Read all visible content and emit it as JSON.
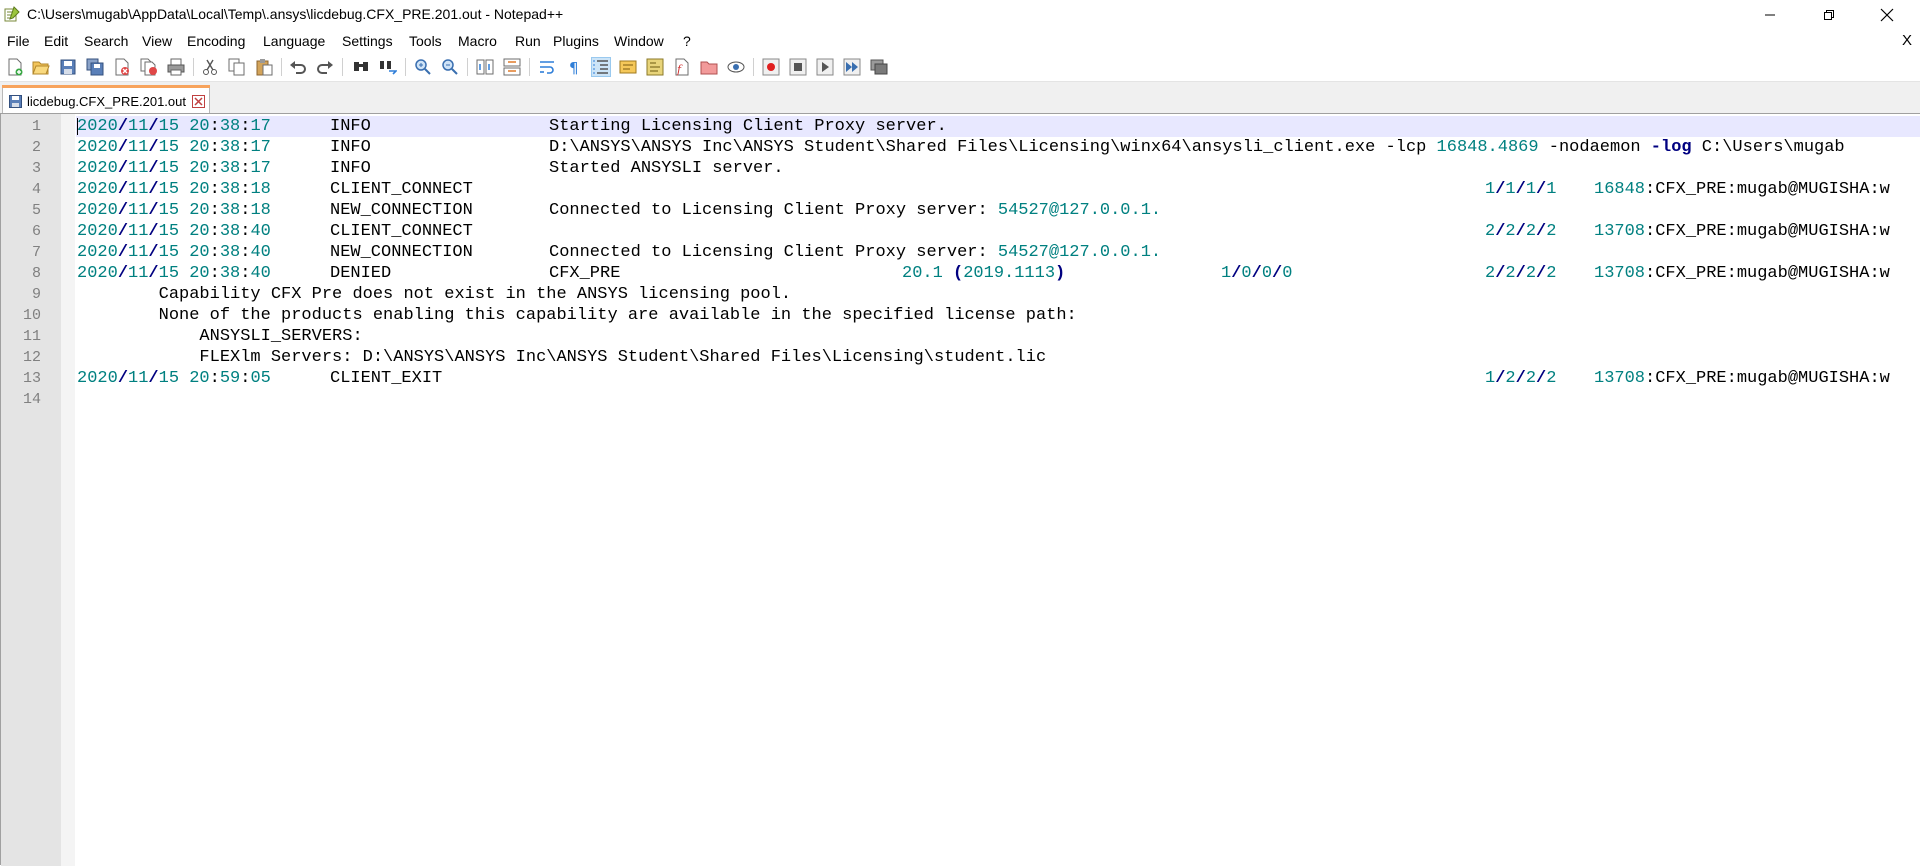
{
  "window": {
    "title": "C:\\Users\\mugab\\AppData\\Local\\Temp\\.ansys\\licdebug.CFX_PRE.201.out - Notepad++"
  },
  "menu": [
    "File",
    "Edit",
    "Search",
    "View",
    "Encoding",
    "Language",
    "Settings",
    "Tools",
    "Macro",
    "Run",
    "Plugins",
    "Window",
    "?"
  ],
  "menu_close": "X",
  "toolbar_icons": [
    "new-file-icon",
    "open-file-icon",
    "save-icon",
    "save-all-icon",
    "close-icon",
    "close-all-icon",
    "print-icon",
    "cut-icon",
    "copy-icon",
    "paste-icon",
    "undo-icon",
    "redo-icon",
    "find-icon",
    "replace-icon",
    "zoom-in-icon",
    "zoom-out-icon",
    "sync-vertical-icon",
    "sync-horizontal-icon",
    "word-wrap-icon",
    "show-all-chars-icon",
    "indent-guide-icon",
    "udl-icon",
    "doc-map-icon",
    "function-list-icon",
    "folder-workspace-icon",
    "monitoring-icon",
    "record-macro-icon",
    "stop-macro-icon",
    "play-macro-icon",
    "run-macro-multiple-icon",
    "save-macro-icon"
  ],
  "tab": {
    "label": "licdebug.CFX_PRE.201.out"
  },
  "colors": {
    "number": "#008080",
    "keyword": "#000080",
    "current_line": "#e8e8ff",
    "tab_accent": "#f7a35c",
    "gutter": "#e4e4e4"
  },
  "editor": {
    "line_numbers": [
      "1",
      "2",
      "3",
      "4",
      "5",
      "6",
      "7",
      "8",
      "9",
      "10",
      "11",
      "12",
      "13",
      "14"
    ],
    "lines": {
      "l1": {
        "ts_d1": "2020",
        "ts_s1": "/",
        "ts_d2": "11",
        "ts_s2": "/",
        "ts_d3": "15",
        "ts_sp": " ",
        "ts_t1": "20",
        "ts_c1": ":",
        "ts_t2": "38",
        "ts_c2": ":",
        "ts_t3": "17",
        "type": "INFO",
        "msg": "Starting Licensing Client Proxy server."
      },
      "l2": {
        "ts_d1": "2020",
        "ts_s1": "/",
        "ts_d2": "11",
        "ts_s2": "/",
        "ts_d3": "15",
        "ts_sp": " ",
        "ts_t1": "20",
        "ts_c1": ":",
        "ts_t2": "38",
        "ts_c2": ":",
        "ts_t3": "17",
        "type": "INFO",
        "msg_a": "D:\\ANSYS\\ANSYS Inc\\ANSYS Student\\Shared Files\\Licensing\\winx64\\ansysli_client.exe -lcp ",
        "msg_num": "16848.4869",
        "msg_b": " -nodaemon ",
        "msg_kw": "-log",
        "msg_c": " C:\\Users\\mugab"
      },
      "l3": {
        "ts_d1": "2020",
        "ts_s1": "/",
        "ts_d2": "11",
        "ts_s2": "/",
        "ts_d3": "15",
        "ts_sp": " ",
        "ts_t1": "20",
        "ts_c1": ":",
        "ts_t2": "38",
        "ts_c2": ":",
        "ts_t3": "17",
        "type": "INFO",
        "msg": "Started ANSYSLI server."
      },
      "l4": {
        "ts_d1": "2020",
        "ts_s1": "/",
        "ts_d2": "11",
        "ts_s2": "/",
        "ts_d3": "15",
        "ts_sp": " ",
        "ts_t1": "20",
        "ts_c1": ":",
        "ts_t2": "38",
        "ts_c2": ":",
        "ts_t3": "18",
        "type": "CLIENT_CONNECT",
        "cnt": [
          "1",
          "/",
          "1",
          "/",
          "1",
          "/",
          "1"
        ],
        "pid": "16848",
        "user": ":CFX_PRE:mugab@MUGISHA:w"
      },
      "l5": {
        "ts_d1": "2020",
        "ts_s1": "/",
        "ts_d2": "11",
        "ts_s2": "/",
        "ts_d3": "15",
        "ts_sp": " ",
        "ts_t1": "20",
        "ts_c1": ":",
        "ts_t2": "38",
        "ts_c2": ":",
        "ts_t3": "18",
        "type": "NEW_CONNECTION",
        "msg": "Connected to Licensing Client Proxy server: ",
        "addr": "54527@127.0.0.1."
      },
      "l6": {
        "ts_d1": "2020",
        "ts_s1": "/",
        "ts_d2": "11",
        "ts_s2": "/",
        "ts_d3": "15",
        "ts_sp": " ",
        "ts_t1": "20",
        "ts_c1": ":",
        "ts_t2": "38",
        "ts_c2": ":",
        "ts_t3": "40",
        "type": "CLIENT_CONNECT",
        "cnt": [
          "2",
          "/",
          "2",
          "/",
          "2",
          "/",
          "2"
        ],
        "pid": "13708",
        "user": ":CFX_PRE:mugab@MUGISHA:w"
      },
      "l7": {
        "ts_d1": "2020",
        "ts_s1": "/",
        "ts_d2": "11",
        "ts_s2": "/",
        "ts_d3": "15",
        "ts_sp": " ",
        "ts_t1": "20",
        "ts_c1": ":",
        "ts_t2": "38",
        "ts_c2": ":",
        "ts_t3": "40",
        "type": "NEW_CONNECTION",
        "msg": "Connected to Licensing Client Proxy server: ",
        "addr": "54527@127.0.0.1."
      },
      "l8": {
        "ts_d1": "2020",
        "ts_s1": "/",
        "ts_d2": "11",
        "ts_s2": "/",
        "ts_d3": "15",
        "ts_sp": " ",
        "ts_t1": "20",
        "ts_c1": ":",
        "ts_t2": "38",
        "ts_c2": ":",
        "ts_t3": "40",
        "type": "DENIED",
        "feature": "CFX_PRE",
        "ver": "20.1",
        "paren_o": " (",
        "build": "2019.1113",
        "paren_c": ")",
        "req": [
          "1",
          "/",
          "0",
          "/",
          "0",
          "/",
          "0"
        ],
        "cnt": [
          "2",
          "/",
          "2",
          "/",
          "2",
          "/",
          "2"
        ],
        "pid": "13708",
        "user": ":CFX_PRE:mugab@MUGISHA:w"
      },
      "l9": {
        "text": "        Capability CFX Pre does not exist in the ANSYS licensing pool."
      },
      "l10": {
        "text": "        None of the products enabling this capability are available in the specified license path:"
      },
      "l11": {
        "text": "            ANSYSLI_SERVERS:"
      },
      "l12": {
        "text": "            FLEXlm Servers: D:\\ANSYS\\ANSYS Inc\\ANSYS Student\\Shared Files\\Licensing\\student.lic"
      },
      "l13": {
        "ts_d1": "2020",
        "ts_s1": "/",
        "ts_d2": "11",
        "ts_s2": "/",
        "ts_d3": "15",
        "ts_sp": " ",
        "ts_t1": "20",
        "ts_c1": ":",
        "ts_t2": "59",
        "ts_c2": ":",
        "ts_t3": "05",
        "type": "CLIENT_EXIT",
        "cnt": [
          "1",
          "/",
          "2",
          "/",
          "2",
          "/",
          "2"
        ],
        "pid": "13708",
        "user": ":CFX_PRE:mugab@MUGISHA:w"
      }
    }
  }
}
